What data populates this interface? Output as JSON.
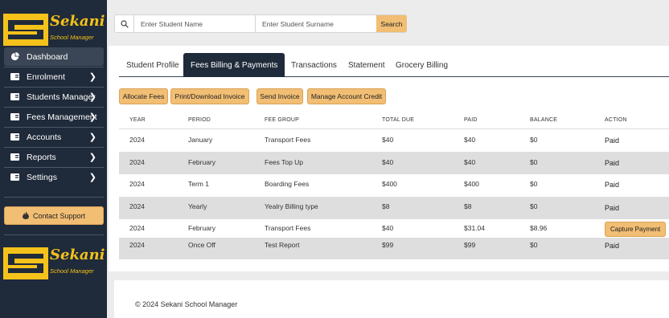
{
  "brand": {
    "name": "Sekani",
    "subtitle": "School Manager"
  },
  "sidebar": {
    "items": [
      {
        "label": "Dashboard",
        "icon": "pie-chart-icon",
        "active": true,
        "chevron": false
      },
      {
        "label": "Enrolment",
        "icon": "id-card-icon",
        "chevron": true
      },
      {
        "label": "Students Manager",
        "icon": "id-card-icon",
        "chevron": true
      },
      {
        "label": "Fees Management",
        "icon": "id-card-icon",
        "chevron": true
      },
      {
        "label": "Accounts",
        "icon": "id-card-icon",
        "chevron": true
      },
      {
        "label": "Reports",
        "icon": "id-card-icon",
        "chevron": true
      },
      {
        "label": "Settings",
        "icon": "id-card-icon",
        "chevron": true
      }
    ],
    "support_label": "Contact Support"
  },
  "search": {
    "name_placeholder": "Enter Student Name",
    "surname_placeholder": "Enter Student Surname",
    "button_label": "Search"
  },
  "tabs": [
    {
      "label": "Student Profile"
    },
    {
      "label": "Fees Billing & Payments",
      "active": true
    },
    {
      "label": "Transactions"
    },
    {
      "label": "Statement"
    },
    {
      "label": "Grocery Billing"
    }
  ],
  "actions": {
    "allocate": "Allocate Fees",
    "print": "Print/Download Invoice",
    "send": "Send Invoice",
    "credit": "Manage Account Credit"
  },
  "table": {
    "headers": {
      "year": "YEAR",
      "period": "PERIOD",
      "fee_group": "FEE GROUP",
      "total_due": "TOTAL DUE",
      "paid": "PAID",
      "balance": "BALANCE",
      "action": "ACTION"
    },
    "rows": [
      {
        "year": "2024",
        "period": "January",
        "fee_group": "Transport Fees",
        "total_due": "$40",
        "paid": "$40",
        "balance": "$0",
        "action": "Paid"
      },
      {
        "year": "2024",
        "period": "February",
        "fee_group": "Fees Top Up",
        "total_due": "$40",
        "paid": "$40",
        "balance": "$0",
        "action": "Paid"
      },
      {
        "year": "2024",
        "period": "Term 1",
        "fee_group": "Boarding Fees",
        "total_due": "$400",
        "paid": "$400",
        "balance": "$0",
        "action": "Paid"
      },
      {
        "year": "2024",
        "period": "Yearly",
        "fee_group": "Yealry Billing type",
        "total_due": "$8",
        "paid": "$8",
        "balance": "$0",
        "action": "Paid"
      },
      {
        "year": "2024",
        "period": "February",
        "fee_group": "Transport Fees",
        "total_due": "$40",
        "paid": "$31.04",
        "balance": "$8.96",
        "action": "Capture Payment"
      },
      {
        "year": "2024",
        "period": "Once Off",
        "fee_group": "Test Report",
        "total_due": "$99",
        "paid": "$99",
        "balance": "$0",
        "action": "Paid"
      }
    ]
  },
  "footer": {
    "text": "© 2024 Sekani School Manager"
  },
  "colors": {
    "sidebar": "#1f2a3a",
    "accent": "#f1be74",
    "brand_yellow": "#f4c21a"
  }
}
